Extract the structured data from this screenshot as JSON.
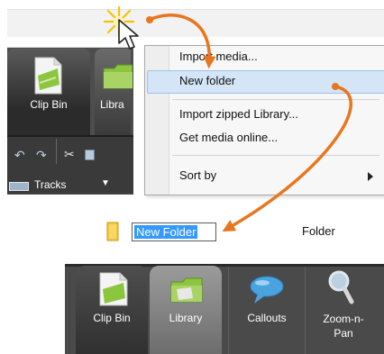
{
  "top_panel": {
    "tabs": [
      {
        "label": "Clip Bin"
      },
      {
        "label": "Libra"
      }
    ],
    "tracks_label": "Tracks"
  },
  "context_menu": {
    "items": [
      {
        "label": "Import media..."
      },
      {
        "label": "New folder",
        "highlighted": true
      },
      {
        "label": "Import zipped Library..."
      },
      {
        "label": "Get media online..."
      },
      {
        "label": "Sort by",
        "submenu": true
      }
    ]
  },
  "rename_row": {
    "name_value": "New Folder",
    "type_value": "Folder"
  },
  "bottom_panel": {
    "tabs": [
      {
        "label": "Clip Bin"
      },
      {
        "label": "Library",
        "active": true
      },
      {
        "label": "Callouts"
      },
      {
        "label": "Zoom-n-Pan"
      }
    ]
  },
  "colors": {
    "arrow": "#e8761e",
    "menu_highlight": "#d4e5f7",
    "selection": "#3399ff",
    "tab_bar": "#4a4a4a"
  },
  "icons": [
    "click-burst-icon",
    "mouse-pointer-icon",
    "folder-icon",
    "clip-bin-icon",
    "library-icon",
    "callouts-icon",
    "zoom-n-pan-icon",
    "undo-icon",
    "redo-icon",
    "cut-icon",
    "copy-icon",
    "tracks-icon",
    "submenu-arrow-icon"
  ]
}
